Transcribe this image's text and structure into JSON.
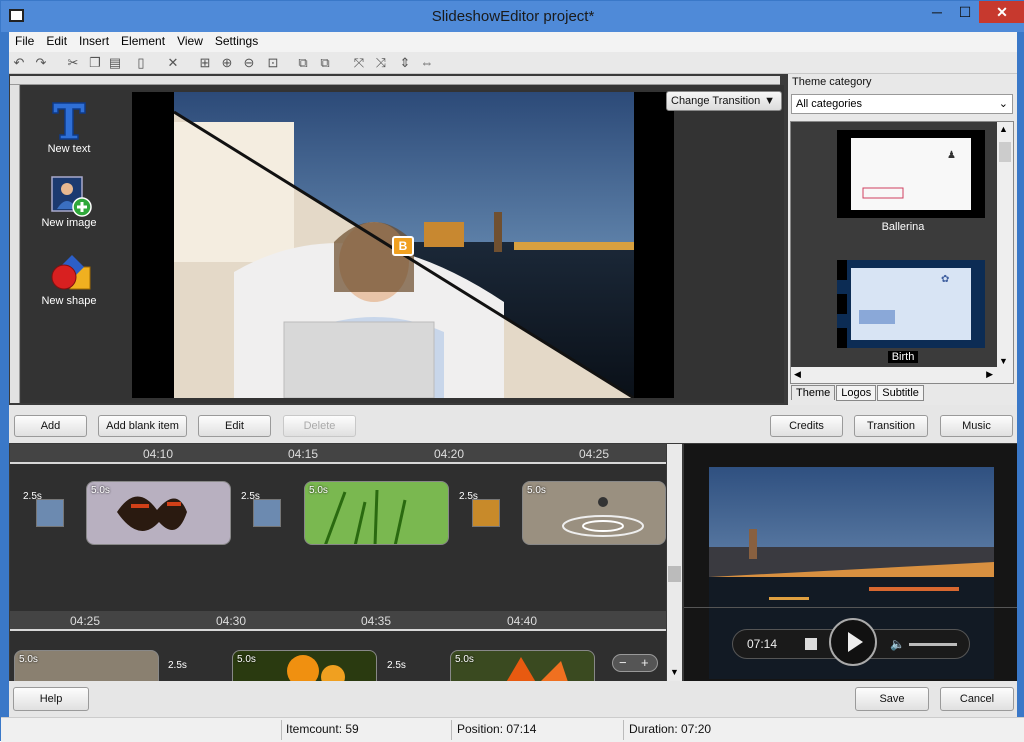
{
  "window": {
    "title": "SlideshowEditor project*",
    "min": "─",
    "max": "☐",
    "close": "✕"
  },
  "menu": [
    "File",
    "Edit",
    "Insert",
    "Element",
    "View",
    "Settings"
  ],
  "tools": {
    "new_text": "New text",
    "new_image": "New image",
    "new_shape": "New shape"
  },
  "change_transition": "Change Transition",
  "theme": {
    "category_label": "Theme category",
    "category_value": "All categories",
    "items": [
      "Ballerina",
      "Birth"
    ],
    "tabs": [
      "Theme",
      "Logos",
      "Subtitle"
    ]
  },
  "actions": {
    "add": "Add",
    "add_blank": "Add blank item",
    "edit": "Edit",
    "delete": "Delete",
    "credits": "Credits",
    "transition": "Transition",
    "music": "Music"
  },
  "timeline": {
    "ruler1": [
      "04:10",
      "04:15",
      "04:20",
      "04:25"
    ],
    "ruler2": [
      "04:25",
      "04:30",
      "04:35",
      "04:40"
    ],
    "row1": {
      "transitions": [
        "2.5s",
        "2.5s",
        "2.5s"
      ],
      "clips": [
        "5.0s",
        "5.0s",
        "5.0s"
      ]
    },
    "row2": {
      "transitions": [
        "2.5s",
        "2.5s"
      ],
      "clips": [
        "5.0s",
        "5.0s",
        "5.0s"
      ]
    },
    "zoom_minus": "−",
    "zoom_plus": "+"
  },
  "player": {
    "time": "07:14"
  },
  "footer": {
    "help": "Help",
    "save": "Save",
    "cancel": "Cancel"
  },
  "status": {
    "itemcount": "Itemcount: 59",
    "position": "Position: 07:14",
    "duration": "Duration: 07:20"
  }
}
